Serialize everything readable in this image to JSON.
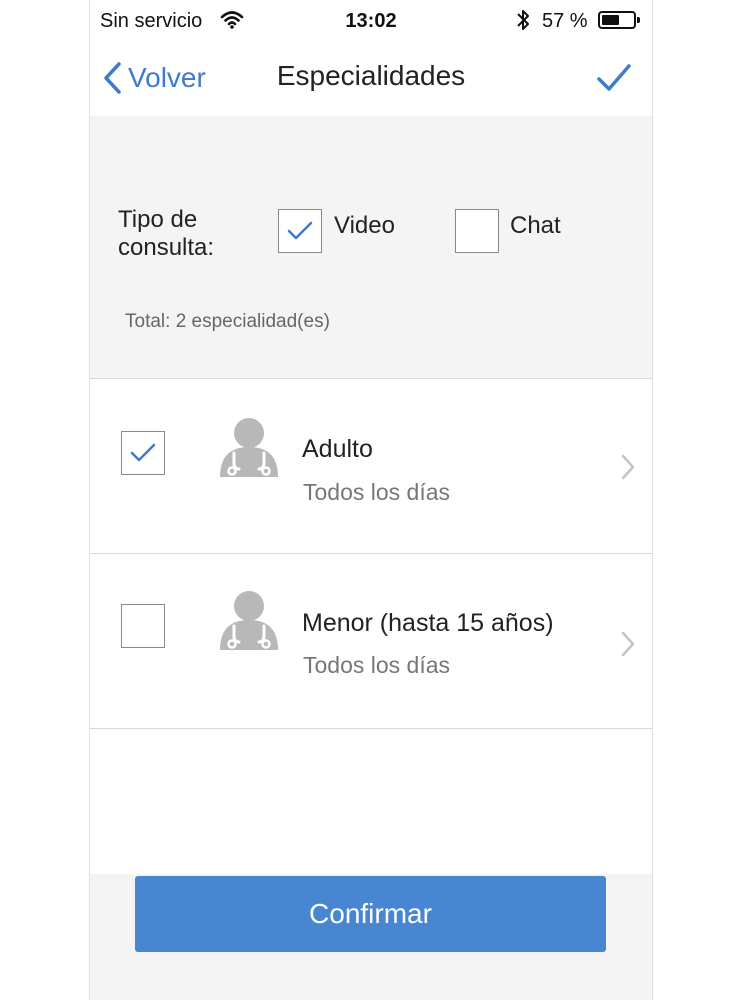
{
  "status_bar": {
    "carrier": "Sin servicio",
    "time": "13:02",
    "battery_pct": "57 %",
    "battery_level": 0.57,
    "icons": [
      "wifi-icon",
      "bluetooth-icon",
      "battery-icon"
    ]
  },
  "nav": {
    "back_label": "Volver",
    "title": "Especialidades",
    "done_icon": "checkmark-icon"
  },
  "filter": {
    "type_label": "Tipo de consulta:",
    "options": [
      {
        "label": "Video",
        "checked": true
      },
      {
        "label": "Chat",
        "checked": false
      }
    ],
    "total": "Total: 2 especialidad(es)"
  },
  "specialties": [
    {
      "title": "Adulto",
      "subtitle": "Todos los días",
      "checked": true,
      "icon": "doctor-avatar-icon"
    },
    {
      "title": "Menor (hasta 15 años)",
      "subtitle": "Todos los días",
      "checked": false,
      "icon": "doctor-avatar-icon"
    }
  ],
  "footer": {
    "confirm_label": "Confirmar"
  },
  "colors": {
    "accent": "#3f7bcc",
    "button": "#4886d2",
    "panel_bg": "#f4f4f4",
    "avatar": "#b8b8b8"
  }
}
